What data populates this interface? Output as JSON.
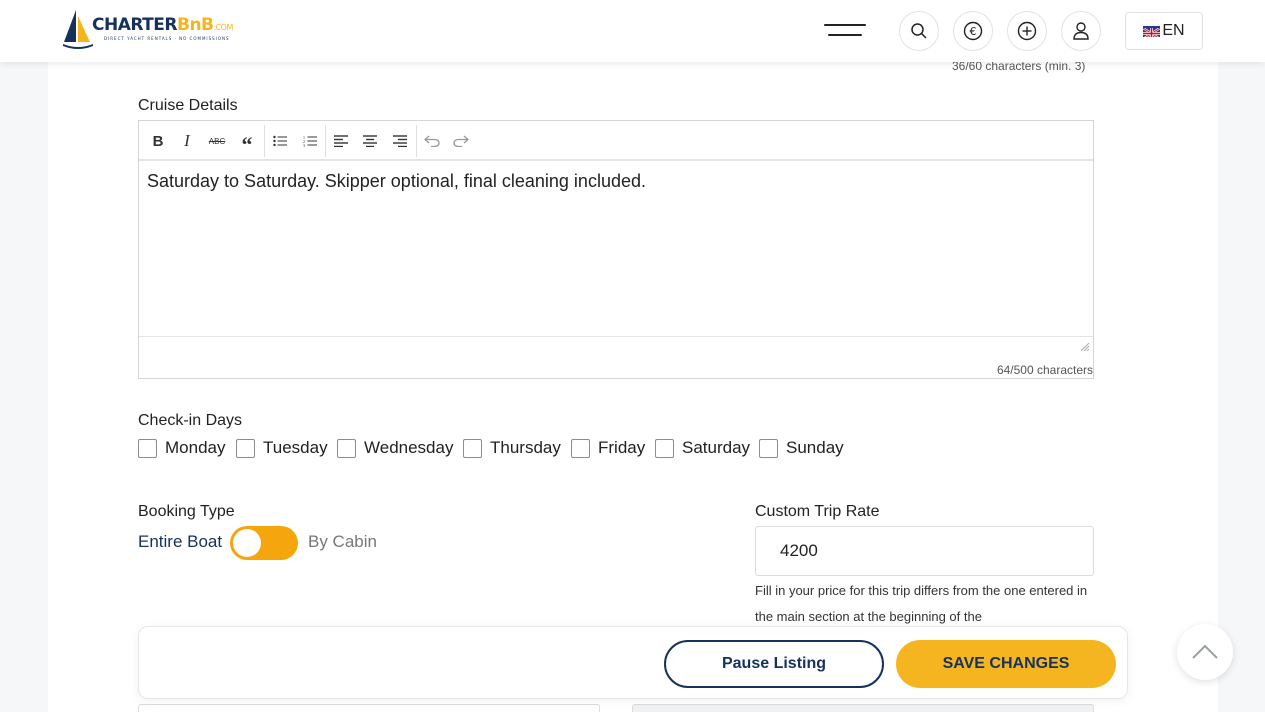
{
  "header": {
    "logo": {
      "brand_main": "CHARTER",
      "brand_accent": "BnB",
      "brand_suffix": ".COM",
      "tagline": "DIRECT YACHT RENTALS · NO COMMISSIONS"
    },
    "icons": [
      "menu-icon",
      "search-icon",
      "euro-icon",
      "plus-circle-icon",
      "user-icon"
    ],
    "language": "EN"
  },
  "title_field": {
    "char_count": "36/60 characters (min. 3)"
  },
  "cruise_details": {
    "label": "Cruise Details",
    "toolbar": [
      "bold",
      "italic",
      "strikethrough",
      "quote",
      "bulleted-list",
      "numbered-list",
      "align-left",
      "align-center",
      "align-right",
      "undo",
      "redo"
    ],
    "toolbar_glyphs": {
      "bold": "B",
      "italic": "I",
      "strike": "ABC",
      "quote": "“"
    },
    "text": "Saturday to Saturday. Skipper optional, final cleaning included.",
    "char_count": "64/500 characters"
  },
  "checkin": {
    "label": "Check-in Days",
    "days": [
      "Monday",
      "Tuesday",
      "Wednesday",
      "Thursday",
      "Friday",
      "Saturday",
      "Sunday"
    ]
  },
  "booking_type": {
    "label": "Booking Type",
    "option_left": "Entire Boat",
    "option_right": "By Cabin",
    "selected": "Entire Boat"
  },
  "custom_rate": {
    "label": "Custom Trip Rate",
    "value": "4200",
    "help": "Fill in your price for this trip differs from the one entered in the main section at the beginning of the"
  },
  "actions": {
    "pause_label": "Pause Listing",
    "save_label": "SAVE CHANGES"
  },
  "colors": {
    "navy": "#16325c",
    "accent": "#f5b521",
    "toggle": "#f5a60d"
  }
}
